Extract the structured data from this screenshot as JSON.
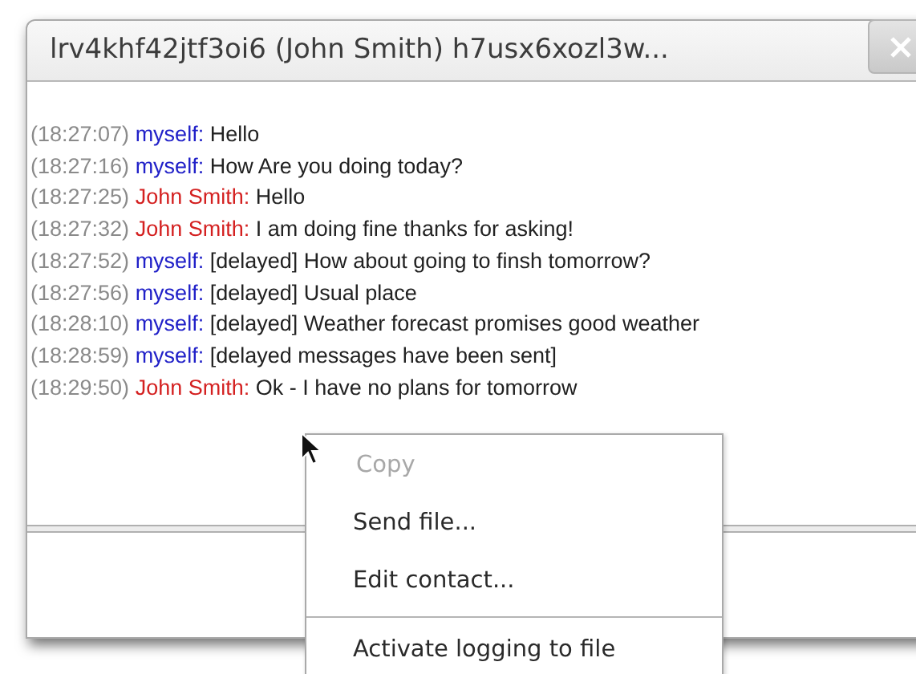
{
  "window": {
    "title": "lrv4khf42jtf3oi6 (John Smith) h7usx6xozl3w..."
  },
  "messages": [
    {
      "time": "(18:27:07)",
      "sender": "myself:",
      "kind": "self",
      "text": "Hello"
    },
    {
      "time": "(18:27:16)",
      "sender": "myself:",
      "kind": "self",
      "text": "How Are you doing today?"
    },
    {
      "time": "(18:27:25)",
      "sender": "John Smith:",
      "kind": "contact",
      "text": "Hello"
    },
    {
      "time": "(18:27:32)",
      "sender": "John Smith:",
      "kind": "contact",
      "text": "I am doing fine thanks for asking!"
    },
    {
      "time": "(18:27:52)",
      "sender": "myself:",
      "kind": "self",
      "text": "[delayed] How about going to finsh tomorrow?"
    },
    {
      "time": "(18:27:56)",
      "sender": "myself:",
      "kind": "self",
      "text": "[delayed] Usual place"
    },
    {
      "time": "(18:28:10)",
      "sender": "myself:",
      "kind": "self",
      "text": "[delayed] Weather forecast promises good weather"
    },
    {
      "time": "(18:28:59)",
      "sender": "myself:",
      "kind": "self",
      "text": "[delayed messages have been sent]"
    },
    {
      "time": "(18:29:50)",
      "sender": "John Smith:",
      "kind": "contact",
      "text": "Ok - I have no plans for tomorrow"
    }
  ],
  "context_menu": [
    {
      "kind": "item",
      "label": "Copy",
      "disabled": true
    },
    {
      "kind": "item",
      "label": "Send file...",
      "disabled": false
    },
    {
      "kind": "item",
      "label": "Edit contact...",
      "disabled": false
    },
    {
      "kind": "separator"
    },
    {
      "kind": "item",
      "label": "Activate logging to file",
      "disabled": false
    }
  ]
}
